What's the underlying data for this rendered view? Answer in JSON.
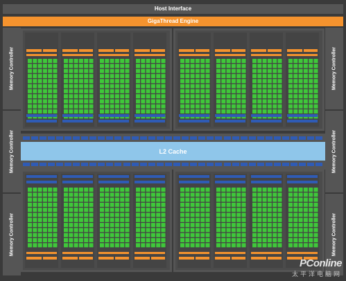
{
  "host_interface": {
    "label": "Host Interface"
  },
  "engine": {
    "label": "GigaThread Engine"
  },
  "l2_cache": {
    "label": "L2 Cache"
  },
  "memory_controllers": [
    {
      "label": "Memory Controller"
    },
    {
      "label": "Memory Controller"
    },
    {
      "label": "Memory Controller"
    },
    {
      "label": "Memory Controller"
    },
    {
      "label": "Memory Controller"
    },
    {
      "label": "Memory Controller"
    }
  ],
  "watermark": {
    "brand": "PConline",
    "sub": "太平洋电脑网"
  },
  "colors": {
    "background": "#3a3a3a",
    "panel": "#555555",
    "cluster": "#4b4b4b",
    "engine": "#f5932e",
    "core": "#3fc83a",
    "scheduler": "#f5932e",
    "load_store": "#2f5bb5",
    "l2": "#8fc6ea"
  },
  "structure": {
    "gpcs": 4,
    "sms_per_gpc": 4,
    "core_rows": 12,
    "core_cols": 6
  }
}
